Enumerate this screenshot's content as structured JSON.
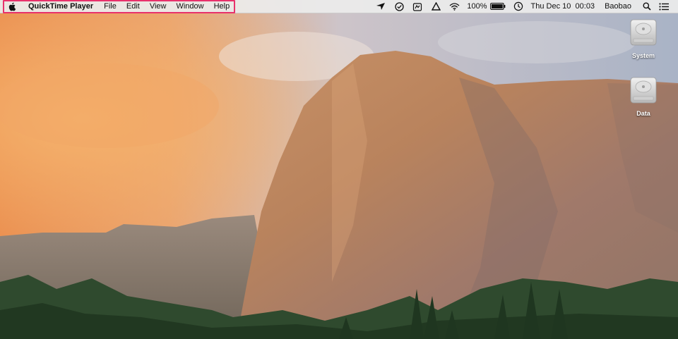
{
  "menubar": {
    "apple_icon": "apple-icon",
    "app_name": "QuickTime Player",
    "menus": [
      "File",
      "Edit",
      "View",
      "Window",
      "Help"
    ],
    "status": {
      "icons": [
        "location-arrow-icon",
        "checkbox-icon",
        "cloud-upload-icon",
        "drive-icon",
        "wifi-icon"
      ],
      "battery_percent": "100%",
      "battery_level": 1.0,
      "datetime": "Thu Dec 10  00:03",
      "user": "Baobao"
    },
    "highlight_color": "#e8316b"
  },
  "desktop": {
    "icons": [
      {
        "label": "System",
        "icon": "hard-drive-icon"
      },
      {
        "label": "Data",
        "icon": "hard-drive-icon"
      }
    ]
  }
}
